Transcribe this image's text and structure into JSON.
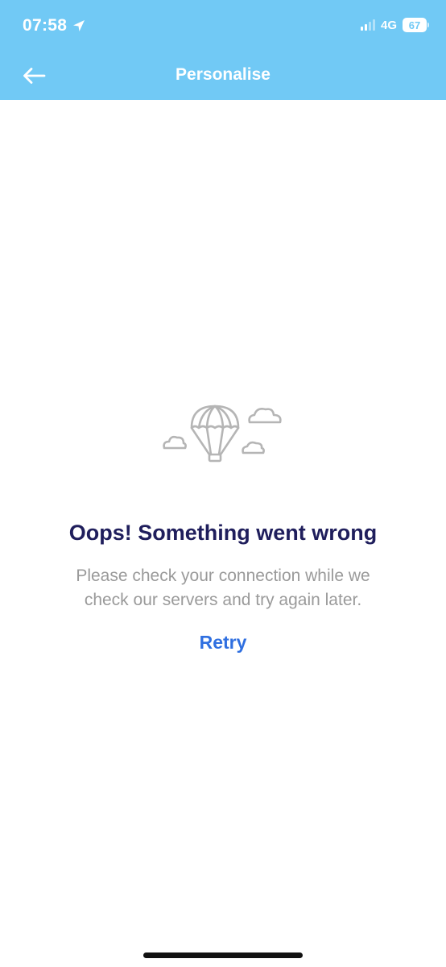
{
  "status_bar": {
    "time": "07:58",
    "network": "4G",
    "battery": "67"
  },
  "nav": {
    "title": "Personalise",
    "back_icon": "arrow-left-icon"
  },
  "error": {
    "illustration_icon": "parachute-clouds-icon",
    "title": "Oops! Something went wrong",
    "message": "Please check your connection while we check our servers and try again later.",
    "retry_label": "Retry"
  },
  "colors": {
    "header": "#71c9f5",
    "title": "#1f1e5c",
    "message": "#9a9a9a",
    "link": "#2f6fe0",
    "illustration": "#b5b5b5"
  }
}
